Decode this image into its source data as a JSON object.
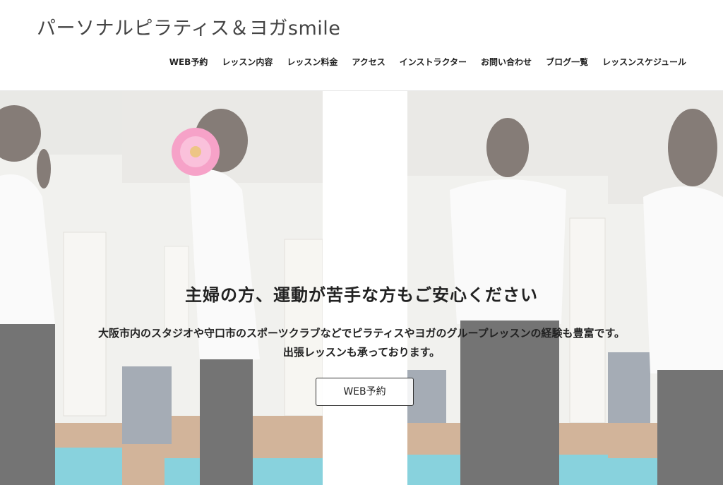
{
  "site": {
    "title": "パーソナルピラティス＆ヨガsmile"
  },
  "nav": {
    "items": [
      {
        "label": "WEB予約"
      },
      {
        "label": "レッスン内容"
      },
      {
        "label": "レッスン料金"
      },
      {
        "label": "アクセス"
      },
      {
        "label": "インストラクター"
      },
      {
        "label": "お問い合わせ"
      },
      {
        "label": "ブログ一覧"
      },
      {
        "label": "レッスンスケジュール"
      }
    ]
  },
  "hero": {
    "headline": "主婦の方、運動が苦手な方もご安心ください",
    "subtext_line1": "大阪市内のスタジオや守口市のスポーツクラブなどでピラティスやヨガのグループレッスンの経験も豊富です。",
    "subtext_line2": "出張レッスンも承っております。",
    "cta_label": "WEB予約"
  },
  "colors": {
    "mat": "#3fb7c9",
    "floor": "#b7865c",
    "wall": "#e9e8e4",
    "shirt": "#f7f7f7",
    "pants": "#202020",
    "flower": "#f06aa7"
  }
}
